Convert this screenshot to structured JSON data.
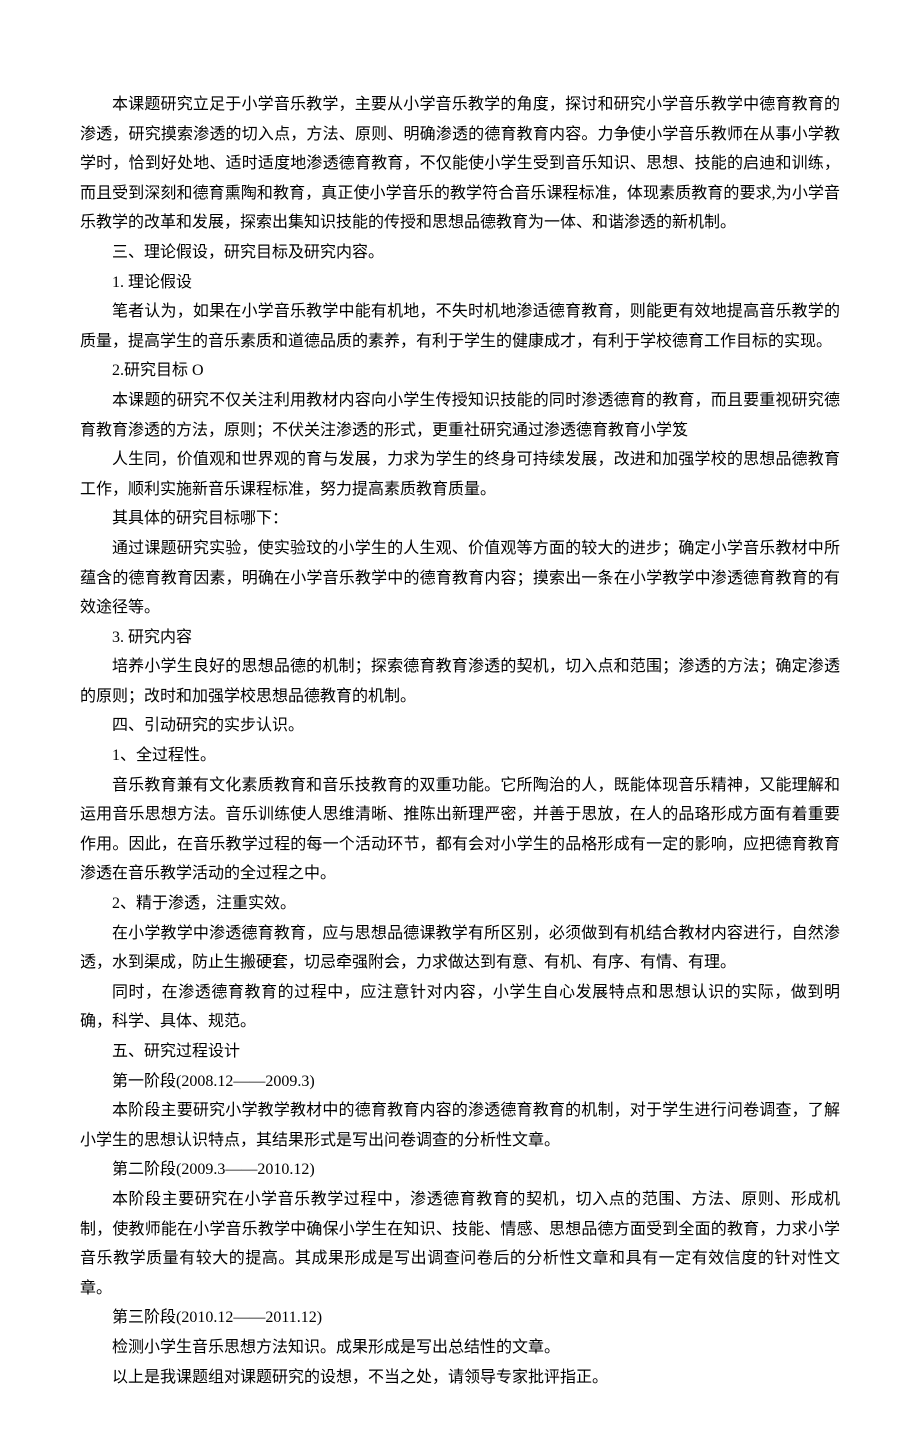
{
  "paragraphs": [
    "本课题研究立足于小学音乐教学，主要从小学音乐教学的角度，探讨和研究小学音乐教学中德育教育的渗透，研究摸索渗透的切入点，方法、原则、明确渗透的德育教育内容。力争使小学音乐教师在从事小学教学时，恰到好处地、适时适度地渗透德育教育，不仅能使小学生受到音乐知识、思想、技能的启迪和训练，而且受到深刻和德育熏陶和教育，真正使小学音乐的教学符合音乐课程标准，体现素质教育的要求,为小学音乐教学的改革和发展，探索出集知识技能的传授和思想品德教育为一体、和谐渗透的新机制。",
    "三、理论假设，研究目标及研究内容。",
    "1. 理论假设",
    "笔者认为，如果在小学音乐教学中能有机地，不失时机地渗适德育教育，则能更有效地提高音乐教学的质量，提高学生的音乐素质和道德品质的素养，有利于学生的健康成才，有利于学校德育工作目标的实现。",
    "2.研究目标 O",
    "本课题的研究不仅关注利用教材内容向小学生传授知识技能的同时渗透德育的教育，而且要重视研究德育教育渗透的方法，原则；不伏关注渗透的形式，更重社研究通过渗透德育教育小学笈",
    "人生同，价值观和世界观的育与发展，力求为学生的终身可持续发展，改进和加强学校的思想品德教育工作，顺利实施新音乐课程标准，努力提高素质教育质量。",
    "其具体的研究目标哪下：",
    "通过课题研究实验，使实验玟的小学生的人生观、价值观等方面的较大的进步；确定小学音乐教材中所蕴含的德育教育因素，明确在小学音乐教学中的德育教育内容；摸索出一条在小学教学中渗透德育教育的有效途径等。",
    "3. 研究内容",
    "培养小学生良好的思想品德的机制；探索德育教育渗透的契机，切入点和范围；渗透的方法；确定渗透的原则；改时和加强学校思想品德教育的机制。",
    "四、引动研究的实步认识。",
    "1、全过程性。",
    "音乐教育兼有文化素质教育和音乐技教育的双重功能。它所陶治的人，既能体现音乐精神，又能理解和运用音乐思想方法。音乐训练使人思维清晰、推陈出新理严密，并善于思放，在人的品珞形成方面有着重要作用。因此，在音乐教学过程的每一个活动环节，都有会对小学生的品格形成有一定的影响，应把德育教育渗透在音乐教学活动的全过程之中。",
    "2、精于渗透，注重实效。",
    "在小学教学中渗透德育教育，应与思想品德课教学有所区别，必须做到有机结合教材内容进行，自然渗透，水到渠成，防止生搬硬套，切忌牵强附会，力求做达到有意、有机、有序、有情、有理。",
    "同时，在渗透德育教育的过程中，应注意针对内容，小学生自心发展特点和思想认识的实际，做到明确，科学、具体、规范。",
    "五、研究过程设计",
    "第一阶段(2008.12——2009.3)",
    "本阶段主要研究小学教学教材中的德育教育内容的渗透德育教育的机制，对于学生进行问卷调查，了解小学生的思想认识特点，其结果形式是写出问卷调查的分析性文章。",
    "第二阶段(2009.3——2010.12)",
    "本阶段主要研究在小学音乐教学过程中，渗透德育教育的契机，切入点的范围、方法、原则、形成机制，使教师能在小学音乐教学中确保小学生在知识、技能、情感、思想品德方面受到全面的教育，力求小学音乐教学质量有较大的提高。其成果形成是写出调查问卷后的分析性文章和具有一定有效信度的针对性文章。",
    "第三阶段(2010.12——2011.12)",
    "检测小学生音乐思想方法知识。成果形成是写出总结性的文章。",
    "以上是我课题组对课题研究的设想，不当之处，请领导专家批评指正。"
  ]
}
